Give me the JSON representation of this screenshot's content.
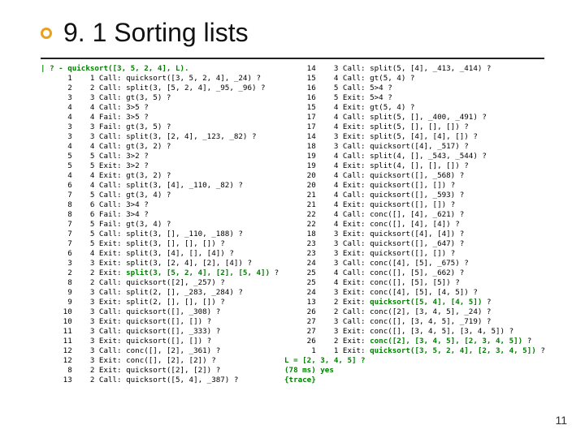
{
  "title": "9. 1 Sorting lists",
  "pagenum": "11",
  "col1": {
    "l00": "| ? - quicksort([3, 5, 2, 4], L).",
    "l01": "      1    1 Call: quicksort([3, 5, 2, 4], _24) ?",
    "l02": "      2    2 Call: split(3, [5, 2, 4], _95, _96) ?",
    "l03": "      3    3 Call: gt(3, 5) ?",
    "l04": "      4    4 Call: 3>5 ?",
    "l05": "      4    4 Fail: 3>5 ?",
    "l06": "      3    3 Fail: gt(3, 5) ?",
    "l07": "      3    3 Call: split(3, [2, 4], _123, _82) ?",
    "l08": "      4    4 Call: gt(3, 2) ?",
    "l09": "      5    5 Call: 3>2 ?",
    "l10": "      5    5 Exit: 3>2 ?",
    "l11": "      4    4 Exit: gt(3, 2) ?",
    "l12": "      6    4 Call: split(3, [4], _110, _82) ?",
    "l13": "      7    5 Call: gt(3, 4) ?",
    "l14": "      8    6 Call: 3>4 ?",
    "l15": "      8    6 Fail: 3>4 ?",
    "l16": "      7    5 Fail: gt(3, 4) ?",
    "l17": "      7    5 Call: split(3, [], _110, _188) ?",
    "l18": "      7    5 Exit: split(3, [], [], []) ?",
    "l19": "      6    4 Exit: split(3, [4], [], [4]) ?",
    "l20": "      3    3 Exit: split(3, [2, 4], [2], [4]) ?",
    "l21a": "      2    2 Exit: ",
    "l21b": "split(3, [5, 2, 4], [2], [5, 4])",
    "l21c": " ?",
    "l22": "      8    2 Call: quicksort([2], _257) ?",
    "l23": "      9    3 Call: split(2, [], _283, _284) ?",
    "l24": "      9    3 Exit: split(2, [], [], []) ?",
    "l25": "     10    3 Call: quicksort([], _308) ?",
    "l26": "     10    3 Exit: quicksort([], []) ?",
    "l27": "     11    3 Call: quicksort([], _333) ?",
    "l28": "     11    3 Exit: quicksort([], []) ?",
    "l29": "     12    3 Call: conc([], [2], _361) ?",
    "l30": "     12    3 Exit: conc([], [2], [2]) ?",
    "l31": "      8    2 Exit: quicksort([2], [2]) ?",
    "l32": "     13    2 Call: quicksort([5, 4], _387) ?"
  },
  "col2": {
    "l00": "     14    3 Call: split(5, [4], _413, _414) ?",
    "l01": "     15    4 Call: gt(5, 4) ?",
    "l02": "     16    5 Call: 5>4 ?",
    "l03": "     16    5 Exit: 5>4 ?",
    "l04": "     15    4 Exit: gt(5, 4) ?",
    "l05": "     17    4 Call: split(5, [], _400, _491) ?",
    "l06": "     17    4 Exit: split(5, [], [], []) ?",
    "l07": "     14    3 Exit: split(5, [4], [4], []) ?",
    "l08": "     18    3 Call: quicksort([4], _517) ?",
    "l09": "     19    4 Call: split(4, [], _543, _544) ?",
    "l10": "     19    4 Exit: split(4, [], [], []) ?",
    "l11": "     20    4 Call: quicksort([], _568) ?",
    "l12": "     20    4 Exit: quicksort([], []) ?",
    "l13": "     21    4 Call: quicksort([], _593) ?",
    "l14": "     21    4 Exit: quicksort([], []) ?",
    "l15": "     22    4 Call: conc([], [4], _621) ?",
    "l16": "     22    4 Exit: conc([], [4], [4]) ?",
    "l17": "     18    3 Exit: quicksort([4], [4]) ?",
    "l18": "     23    3 Call: quicksort([], _647) ?",
    "l19": "     23    3 Exit: quicksort([], []) ?",
    "l20": "     24    3 Call: conc([4], [5], _675) ?",
    "l21": "     25    4 Call: conc([], [5], _662) ?",
    "l22": "     25    4 Exit: conc([], [5], [5]) ?",
    "l23": "     24    3 Exit: conc([4], [5], [4, 5]) ?",
    "l24a": "     13    2 Exit: ",
    "l24b": "quicksort([5, 4], [4, 5])",
    "l24c": " ?",
    "l25": "     26    2 Call: conc([2], [3, 4, 5], _24) ?",
    "l26": "     27    3 Call: conc([], [3, 4, 5], _719) ?",
    "l27": "     27    3 Exit: conc([], [3, 4, 5], [3, 4, 5]) ?",
    "l28a": "     26    2 Exit: ",
    "l28b": "conc([2], [3, 4, 5], [2, 3, 4, 5])",
    "l28c": " ?",
    "l29a": "      1    1 Exit: ",
    "l29b": "quicksort([3, 5, 2, 4], [2, 3, 4, 5])",
    "l29c": " ?",
    "l30": "L = [2, 3, 4, 5] ?",
    "l31": "(78 ms) yes",
    "l32": "{trace}"
  }
}
